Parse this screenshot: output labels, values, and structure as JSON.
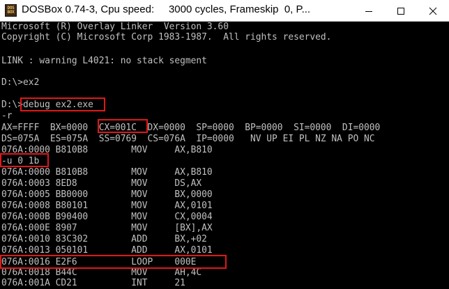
{
  "window": {
    "title": "DOSBox 0.74-3, Cpu speed:     3000 cycles, Frameskip  0, P...",
    "app_icon_text": [
      "DOS",
      "BOX"
    ]
  },
  "console": {
    "lines": [
      "Microsoft (R) Overlay Linker  Version 3.60",
      "Copyright (C) Microsoft Corp 1983-1987.  All rights reserved.",
      "",
      "LINK : warning L4021: no stack segment",
      "",
      "D:\\>ex2",
      "",
      "D:\\>debug ex2.exe",
      "-r",
      "AX=FFFF  BX=0000  CX=001C  DX=0000  SP=0000  BP=0000  SI=0000  DI=0000",
      "DS=075A  ES=075A  SS=0769  CS=076A  IP=0000   NV UP EI PL NZ NA PO NC",
      "076A:0000 B810B8        MOV     AX,B810",
      "-u 0 1b",
      "076A:0000 B810B8        MOV     AX,B810",
      "076A:0003 8ED8          MOV     DS,AX",
      "076A:0005 BB0000        MOV     BX,0000",
      "076A:0008 B80101        MOV     AX,0101",
      "076A:000B B90400        MOV     CX,0004",
      "076A:000E 8907          MOV     [BX],AX",
      "076A:0010 83C302        ADD     BX,+02",
      "076A:0013 050101        ADD     AX,0101",
      "076A:0016 E2F6          LOOP    000E",
      "076A:0018 B44C          MOV     AH,4C",
      "076A:001A CD21          INT     21"
    ]
  },
  "colors": {
    "console_background": "#000000",
    "console_text": "#c0c0c0",
    "highlight_box": "#e01818",
    "titlebar": "#ffffff"
  },
  "icons": {
    "minimize": "minimize-icon",
    "maximize": "maximize-icon",
    "close": "close-icon"
  }
}
